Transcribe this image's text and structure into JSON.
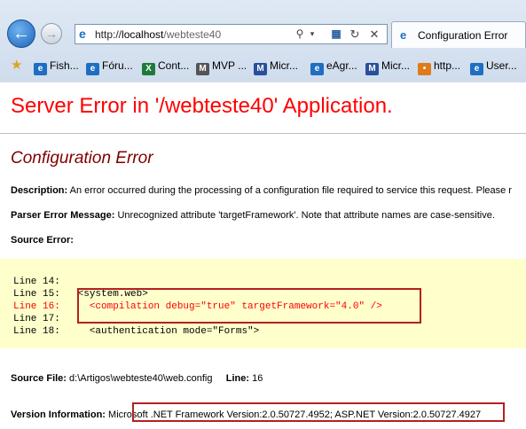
{
  "browser": {
    "address_scheme": "http://",
    "address_host": "localhost",
    "address_path": "/webteste40",
    "tab_title": "Configuration Error",
    "search_icon": "search-icon",
    "refresh_icon": "refresh-icon",
    "stop_icon": "stop-icon"
  },
  "favorites": [
    {
      "label": "Fish...",
      "icon": "ie-icon",
      "color": "#1e6ec1"
    },
    {
      "label": "Fóru...",
      "icon": "ie-icon",
      "color": "#1e6ec1"
    },
    {
      "label": "Cont...",
      "icon": "excel-icon",
      "color": "#1f7a3a"
    },
    {
      "label": "MVP ...",
      "icon": "mvp-icon",
      "color": "#555555"
    },
    {
      "label": "Micr...",
      "icon": "msdn-icon",
      "color": "#2a4f9b"
    },
    {
      "label": "eAgr...",
      "icon": "ie-icon",
      "color": "#1e6ec1"
    },
    {
      "label": "Micr...",
      "icon": "msdn-icon",
      "color": "#2a4f9b"
    },
    {
      "label": "http...",
      "icon": "dots-icon",
      "color": "#e07b1a"
    },
    {
      "label": "User...",
      "icon": "ie-icon",
      "color": "#1e6ec1"
    }
  ],
  "page": {
    "heading": "Server Error in '/webteste40' Application.",
    "subheading": "Configuration Error",
    "description_label": "Description:",
    "description_text": "An error occurred during the processing of a configuration file required to service this request. Please r",
    "parser_label": "Parser Error Message:",
    "parser_text": "Unrecognized attribute 'targetFramework'. Note that attribute names are case-sensitive.",
    "source_error_label": "Source Error:",
    "code_lines": [
      {
        "text": "Line 14:",
        "error": false
      },
      {
        "text": "Line 15:   <system.web>",
        "error": false
      },
      {
        "text": "Line 16:     <compilation debug=\"true\" targetFramework=\"4.0\" />",
        "error": true
      },
      {
        "text": "Line 17:",
        "error": false
      },
      {
        "text": "Line 18:     <authentication mode=\"Forms\">",
        "error": false
      }
    ],
    "source_file_label": "Source File:",
    "source_file_value": "d:\\Artigos\\webteste40\\web.config",
    "line_label": "Line:",
    "line_value": "16",
    "version_label": "Version Information:",
    "version_text": "Microsoft .NET Framework Version:2.0.50727.4952; ASP.NET Version:2.0.50727.4927"
  },
  "colors": {
    "heading": "#ff0000",
    "subheading": "#800000",
    "code_background": "#ffffcc",
    "highlight_border": "#b32020"
  }
}
